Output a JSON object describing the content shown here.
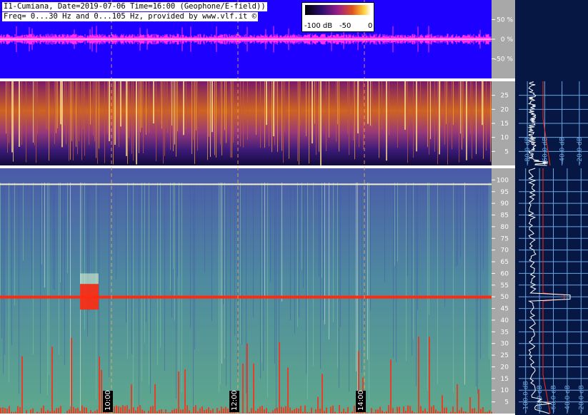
{
  "header": {
    "line1": "I1-Cumiana, Date=2019-07-06 Time=16:00 (Geophone/E-field))",
    "line2": "Freq= 0...30 Hz and 0...105 Hz, provided by www.vlf.it ©"
  },
  "colorbar": {
    "labels": [
      "-100 dB",
      "-50",
      "0"
    ]
  },
  "colors": {
    "top_background": "#1e00ff",
    "waveform": "#ff2ef0",
    "right_panel": "#061744",
    "grid": "#6aa6e0",
    "hum_line": "#ff2a10"
  },
  "chart_data": [
    {
      "type": "line",
      "panel": "amplitude",
      "yticks": [
        "50 %",
        "0 %",
        "-50 %"
      ],
      "ylim": [
        -100,
        100
      ],
      "grid": true
    },
    {
      "type": "heatmap",
      "panel": "spectrogram-low",
      "frequency_range_hz": [
        0,
        30
      ],
      "yticks": [
        25,
        20,
        15,
        10,
        5
      ],
      "colormap": "black-purple-orange-yellow-white"
    },
    {
      "type": "heatmap",
      "panel": "spectrogram-high",
      "frequency_range_hz": [
        0,
        105
      ],
      "yticks": [
        100,
        95,
        90,
        85,
        80,
        75,
        70,
        65,
        60,
        55,
        50,
        45,
        40,
        35,
        30,
        25,
        20,
        15,
        10,
        5
      ],
      "time_labels": [
        "10:00",
        "12:00",
        "14:00"
      ],
      "notable_lines_hz": [
        50,
        98
      ],
      "colormap": "blue-green-white-red"
    },
    {
      "type": "line",
      "panel": "spectrum-low",
      "xticks": [
        "-80.0 dB",
        "-60.0 dB",
        "-40.0 dB",
        "-20.0 dB"
      ],
      "grid": true
    },
    {
      "type": "line",
      "panel": "spectrum-high",
      "xticks": [
        "-100.0 dB",
        "-80.0 dB",
        "-60.0 dB",
        "-40.0 dB",
        "-20.0 dB"
      ],
      "grid": true
    }
  ]
}
